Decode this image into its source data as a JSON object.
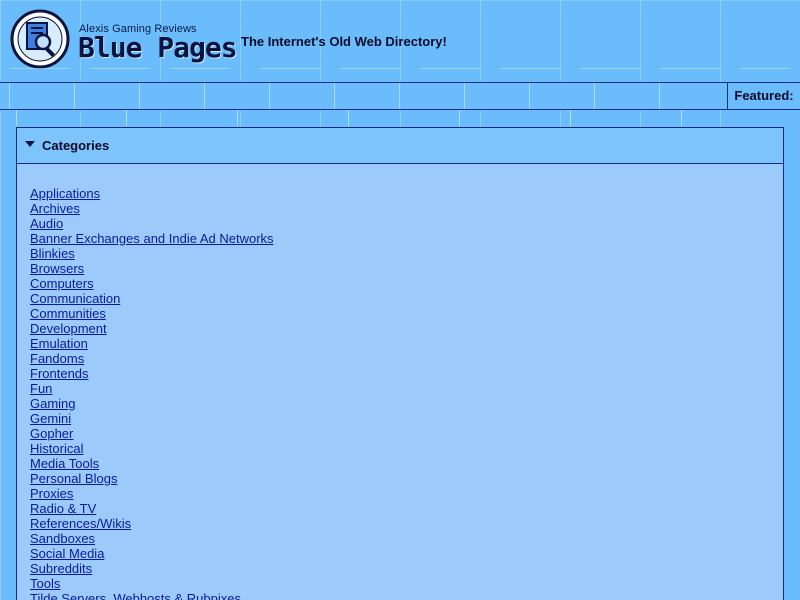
{
  "header": {
    "brand_small": "Alexis Gaming Reviews",
    "brand_big": "Blue Pages",
    "tagline": "The Internet's Old Web Directory!",
    "logo_icon": "magnifier-book-icon"
  },
  "nav": {
    "featured_label": "Featured:"
  },
  "categories": {
    "title": "Categories",
    "items": [
      "Applications",
      "Archives",
      "Audio",
      "Banner Exchanges and Indie Ad Networks",
      "Blinkies",
      "Browsers",
      "Computers",
      "Communication",
      "Communities",
      "Development",
      "Emulation",
      "Fandoms",
      "Frontends",
      "Fun",
      "Gaming",
      "Gemini",
      "Gopher",
      "Historical",
      "Media Tools",
      "Personal Blogs",
      "Proxies",
      "Radio & TV",
      "References/Wikis",
      "Sandboxes",
      "Social Media",
      "Subreddits",
      "Tools",
      "Tilde Servers, Webhosts & Rubpixes"
    ]
  },
  "colors": {
    "background": "#6bbcfa",
    "panel": "#9ccbfb",
    "border": "#1a2a7a",
    "link": "#0a1a9a"
  }
}
